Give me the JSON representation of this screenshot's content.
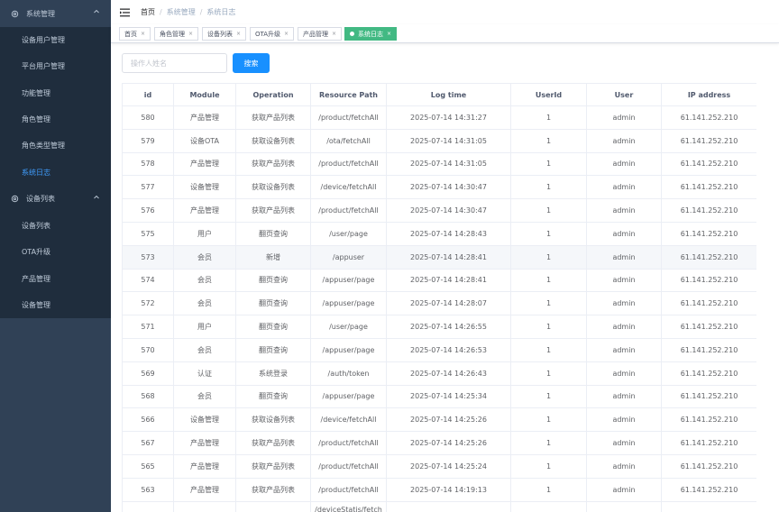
{
  "sidebar": {
    "group1": {
      "title": "系统管理",
      "icon": "gear-icon",
      "items": [
        {
          "label": "设备用户管理"
        },
        {
          "label": "平台用户管理"
        },
        {
          "label": "功能管理"
        },
        {
          "label": "角色管理"
        },
        {
          "label": "角色类型管理"
        },
        {
          "label": "系统日志",
          "active": true
        }
      ]
    },
    "group2": {
      "title": "设备列表",
      "icon": "gear-icon",
      "items": [
        {
          "label": "设备列表"
        },
        {
          "label": "OTA升级"
        },
        {
          "label": "产品管理"
        },
        {
          "label": "设备管理"
        }
      ]
    }
  },
  "breadcrumb": {
    "home": "首页",
    "sep": "/",
    "level1": "系统管理",
    "level2": "系统日志"
  },
  "tags": [
    {
      "label": "首页"
    },
    {
      "label": "角色管理"
    },
    {
      "label": "设备列表"
    },
    {
      "label": "OTA升级"
    },
    {
      "label": "产品管理"
    },
    {
      "label": "系统日志",
      "active": true
    }
  ],
  "tag_close": "×",
  "search": {
    "placeholder": "操作人姓名",
    "value": "",
    "button": "搜索"
  },
  "table": {
    "headers": [
      "id",
      "Module",
      "Operation",
      "Resource Path",
      "Log time",
      "UserId",
      "User",
      "IP address"
    ],
    "rows": [
      [
        "580",
        "产品管理",
        "获取产品列表",
        "/product/fetchAll",
        "2025-07-14 14:31:27",
        "1",
        "admin",
        "61.141.252.210"
      ],
      [
        "579",
        "设备OTA",
        "获取设备列表",
        "/ota/fetchAll",
        "2025-07-14 14:31:05",
        "1",
        "admin",
        "61.141.252.210"
      ],
      [
        "578",
        "产品管理",
        "获取产品列表",
        "/product/fetchAll",
        "2025-07-14 14:31:05",
        "1",
        "admin",
        "61.141.252.210"
      ],
      [
        "577",
        "设备管理",
        "获取设备列表",
        "/device/fetchAll",
        "2025-07-14 14:30:47",
        "1",
        "admin",
        "61.141.252.210"
      ],
      [
        "576",
        "产品管理",
        "获取产品列表",
        "/product/fetchAll",
        "2025-07-14 14:30:47",
        "1",
        "admin",
        "61.141.252.210"
      ],
      [
        "575",
        "用户",
        "翻页查询",
        "/user/page",
        "2025-07-14 14:28:43",
        "1",
        "admin",
        "61.141.252.210"
      ],
      [
        "573",
        "会员",
        "新增",
        "/appuser",
        "2025-07-14 14:28:41",
        "1",
        "admin",
        "61.141.252.210"
      ],
      [
        "574",
        "会员",
        "翻页查询",
        "/appuser/page",
        "2025-07-14 14:28:41",
        "1",
        "admin",
        "61.141.252.210"
      ],
      [
        "572",
        "会员",
        "翻页查询",
        "/appuser/page",
        "2025-07-14 14:28:07",
        "1",
        "admin",
        "61.141.252.210"
      ],
      [
        "571",
        "用户",
        "翻页查询",
        "/user/page",
        "2025-07-14 14:26:55",
        "1",
        "admin",
        "61.141.252.210"
      ],
      [
        "570",
        "会员",
        "翻页查询",
        "/appuser/page",
        "2025-07-14 14:26:53",
        "1",
        "admin",
        "61.141.252.210"
      ],
      [
        "569",
        "认证",
        "系统登录",
        "/auth/token",
        "2025-07-14 14:26:43",
        "1",
        "admin",
        "61.141.252.210"
      ],
      [
        "568",
        "会员",
        "翻页查询",
        "/appuser/page",
        "2025-07-14 14:25:34",
        "1",
        "admin",
        "61.141.252.210"
      ],
      [
        "566",
        "设备管理",
        "获取设备列表",
        "/device/fetchAll",
        "2025-07-14 14:25:26",
        "1",
        "admin",
        "61.141.252.210"
      ],
      [
        "567",
        "产品管理",
        "获取产品列表",
        "/product/fetchAll",
        "2025-07-14 14:25:26",
        "1",
        "admin",
        "61.141.252.210"
      ],
      [
        "565",
        "产品管理",
        "获取产品列表",
        "/product/fetchAll",
        "2025-07-14 14:25:24",
        "1",
        "admin",
        "61.141.252.210"
      ],
      [
        "563",
        "产品管理",
        "获取产品列表",
        "/product/fetchAll",
        "2025-07-14 14:19:13",
        "1",
        "admin",
        "61.141.252.210"
      ],
      [
        "",
        "",
        "",
        "/deviceStatis/fetch",
        "",
        "",
        "",
        ""
      ]
    ],
    "hover_row": 6
  },
  "colors": {
    "sidebar_bg": "#304156",
    "submenu_bg": "#1f2d3d",
    "active_menu": "#409eff",
    "active_tag": "#42b983",
    "primary_button": "#1890ff"
  }
}
